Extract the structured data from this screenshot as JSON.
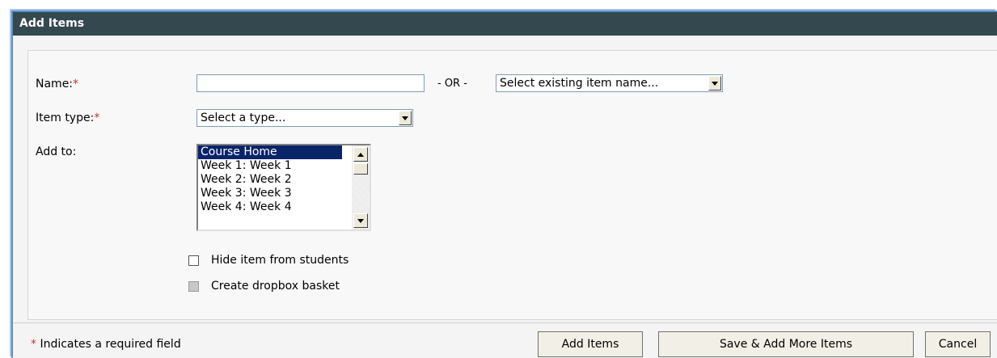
{
  "dialog": {
    "title": "Add Items"
  },
  "form": {
    "name_label": "Name:",
    "required_mark": "*",
    "name_value": "",
    "or_text": "- OR -",
    "existing_select_value": "Select existing item name...",
    "item_type_label": "Item type:",
    "item_type_value": "Select a type...",
    "add_to_label": "Add to:",
    "add_to_options": [
      "Course Home",
      "Week 1: Week 1",
      "Week 2: Week 2",
      "Week 3: Week 3",
      "Week 4: Week 4"
    ],
    "add_to_selected": "Course Home",
    "hide_item_label": "Hide item from students",
    "hide_item_checked": false,
    "dropbox_label": "Create dropbox basket",
    "dropbox_checked": false,
    "dropbox_disabled": true
  },
  "footer": {
    "required_note": "Indicates a required field",
    "add_items_button": "Add Items",
    "save_add_more_button": "Save & Add More Items",
    "cancel_button": "Cancel"
  },
  "colors": {
    "title_bar": "#34484f",
    "selected_option": "#0a246a",
    "required": "#c0392b"
  }
}
